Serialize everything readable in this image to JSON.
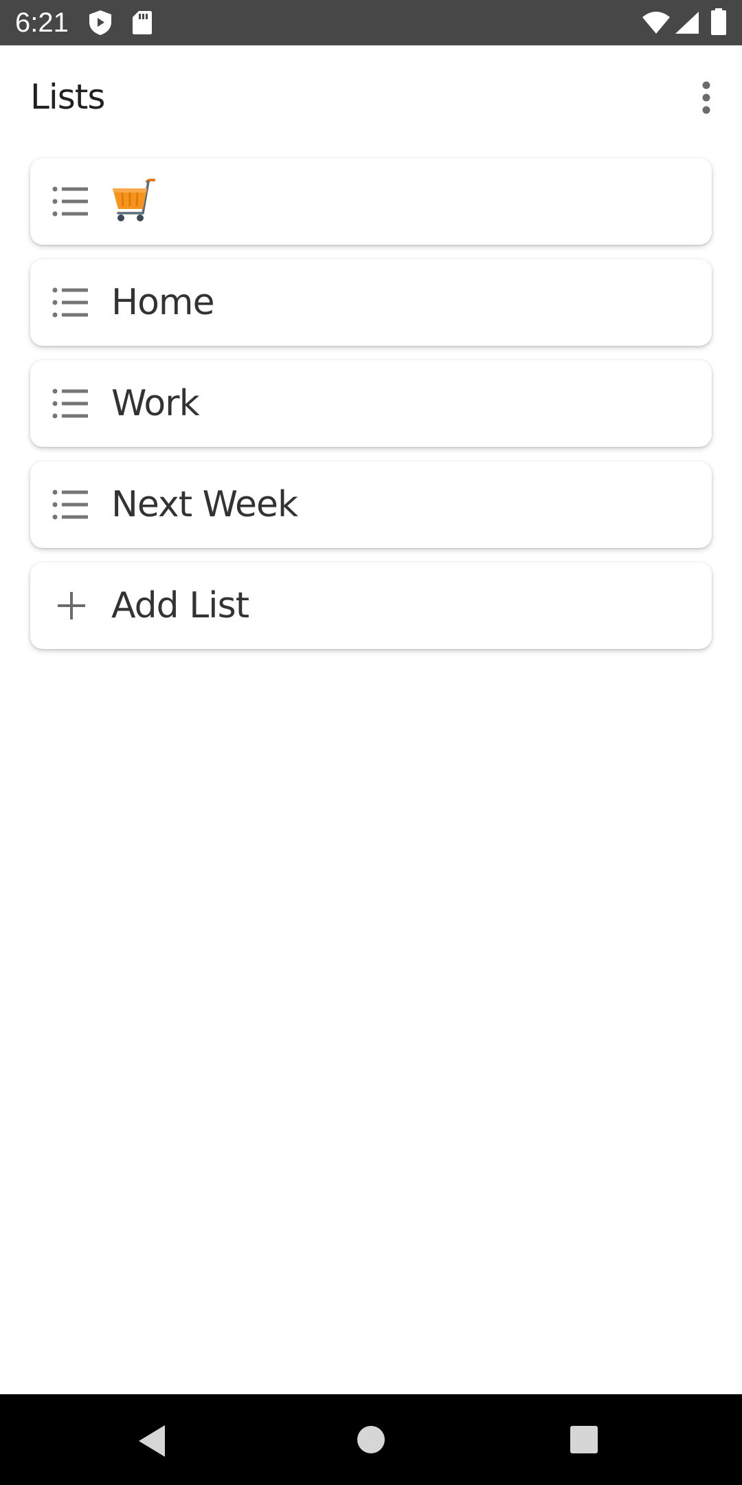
{
  "status_bar": {
    "time": "6:21",
    "icons": [
      "shield-icon",
      "sd-card-icon",
      "wifi-icon",
      "signal-icon",
      "battery-icon"
    ]
  },
  "app_bar": {
    "title": "Lists",
    "overflow_icon": "more-vert-icon"
  },
  "lists": {
    "items": [
      {
        "label": "",
        "icon": "list-icon",
        "emoji": "shopping-cart-icon"
      },
      {
        "label": "Home",
        "icon": "list-icon"
      },
      {
        "label": "Work",
        "icon": "list-icon"
      },
      {
        "label": "Next Week",
        "icon": "list-icon"
      }
    ],
    "add": {
      "label": "Add List",
      "icon": "plus-icon"
    }
  },
  "nav_bar": {
    "buttons": [
      "back-icon",
      "home-icon",
      "recents-icon"
    ]
  },
  "colors": {
    "status_bar": "#474747",
    "text": "#333333",
    "icon_gray": "#757575",
    "cart_orange": "#f7941d"
  }
}
